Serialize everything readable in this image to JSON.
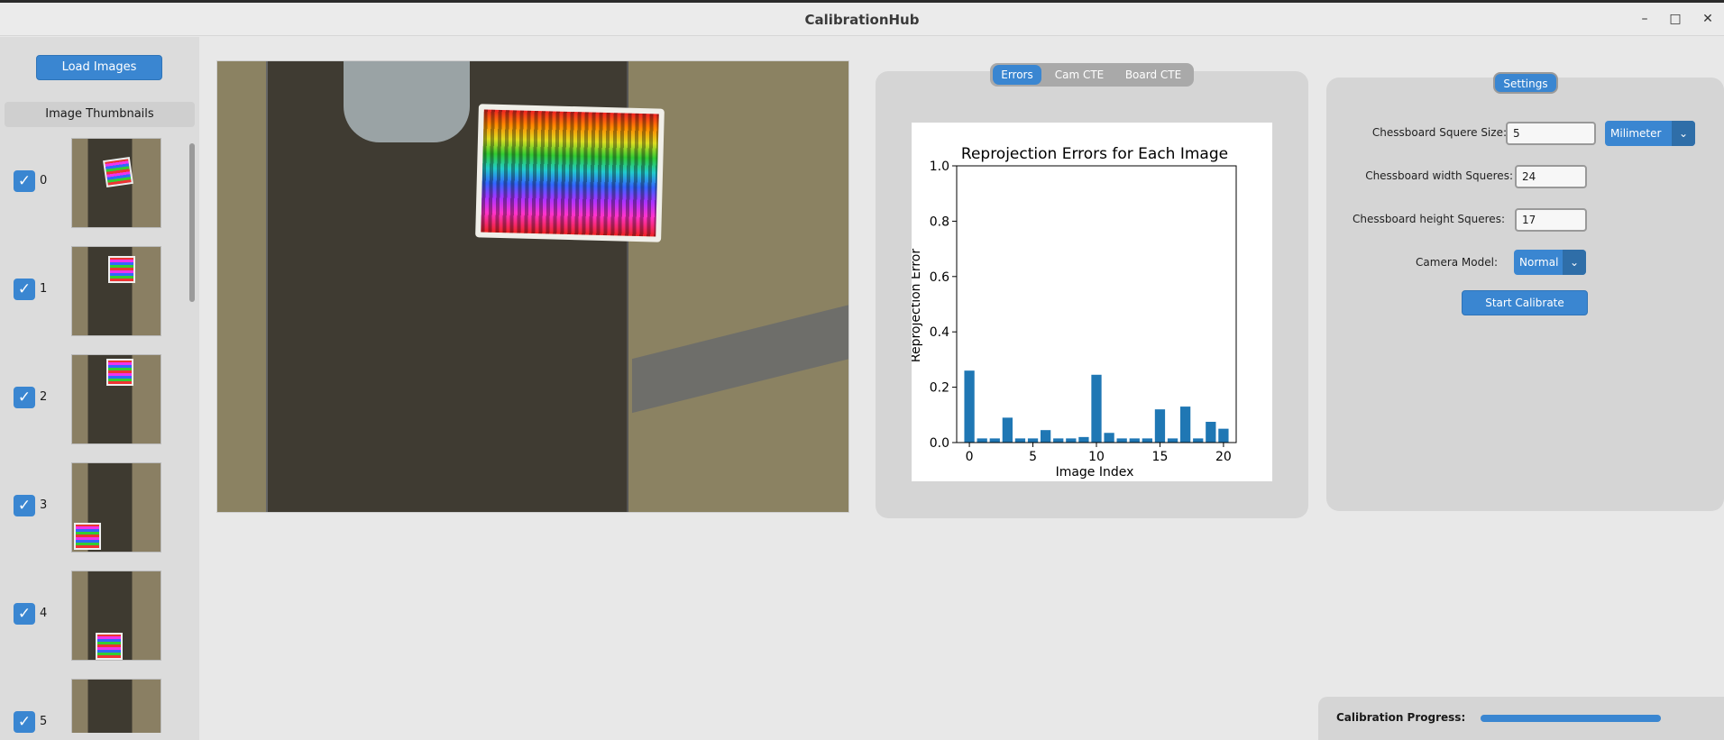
{
  "window": {
    "title": "CalibrationHub"
  },
  "sidebar": {
    "load_button": "Load Images",
    "thumbnails_header": "Image Thumbnails",
    "thumbnails": [
      {
        "index": "0",
        "checked": true
      },
      {
        "index": "1",
        "checked": true
      },
      {
        "index": "2",
        "checked": true
      },
      {
        "index": "3",
        "checked": true
      },
      {
        "index": "4",
        "checked": true
      },
      {
        "index": "5",
        "checked": true
      }
    ]
  },
  "tabs": [
    {
      "label": "Errors",
      "active": true
    },
    {
      "label": "Cam CTE",
      "active": false
    },
    {
      "label": "Board CTE",
      "active": false
    }
  ],
  "chart_data": {
    "type": "bar",
    "title": "Reprojection Errors for Each Image",
    "xlabel": "Image Index",
    "ylabel": "Reprojection Error",
    "x": [
      0,
      1,
      2,
      3,
      4,
      5,
      6,
      7,
      8,
      9,
      10,
      11,
      12,
      13,
      14,
      15,
      16,
      17,
      18,
      19,
      20
    ],
    "values": [
      0.26,
      0.015,
      0.015,
      0.09,
      0.015,
      0.015,
      0.045,
      0.015,
      0.015,
      0.02,
      0.245,
      0.035,
      0.015,
      0.015,
      0.015,
      0.12,
      0.015,
      0.13,
      0.015,
      0.075,
      0.05
    ],
    "xticks": [
      "0",
      "5",
      "10",
      "15",
      "20"
    ],
    "yticks": [
      "0.0",
      "0.2",
      "0.4",
      "0.6",
      "0.8",
      "1.0"
    ],
    "ylim": [
      0,
      1.0
    ],
    "xlim": [
      -1,
      21
    ],
    "color": "#1f77b4"
  },
  "settings": {
    "tab_label": "Settings",
    "square_size_label": "Chessboard Squere Size:",
    "square_size_value": "5",
    "unit_value": "Milimeter",
    "width_label": "Chessboard width Squeres:",
    "width_value": "24",
    "height_label": "Chessboard height Squeres:",
    "height_value": "17",
    "camera_model_label": "Camera Model:",
    "camera_model_value": "Normal",
    "start_button": "Start Calibrate"
  },
  "progress": {
    "label": "Calibration Progress:",
    "value": 1.0
  },
  "colors": {
    "accent": "#3a86d1",
    "bar": "#1f77b4"
  }
}
